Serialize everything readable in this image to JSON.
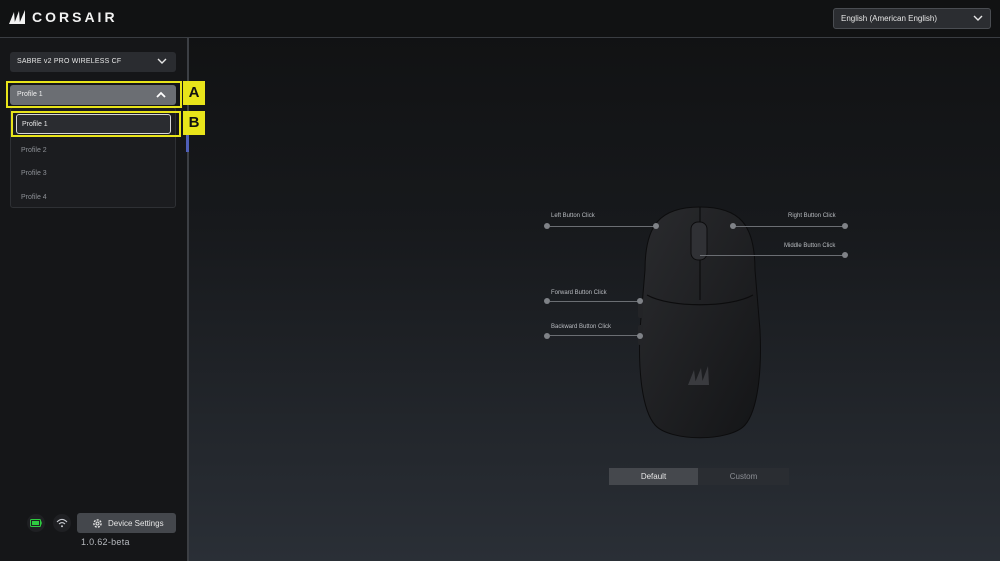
{
  "header": {
    "brand": "CORSAIR",
    "language": "English (American English)"
  },
  "sidebar": {
    "device": "SABRE v2 PRO WIRELESS CF",
    "profile_selected": "Profile 1",
    "profiles": [
      "Profile 1",
      "Profile 2",
      "Profile 3",
      "Profile 4"
    ],
    "device_settings_label": "Device Settings",
    "version": "1.0.62-beta"
  },
  "callouts": {
    "a": "A",
    "b": "B"
  },
  "mouse": {
    "left_button": "Left Button Click",
    "right_button": "Right Button Click",
    "middle_button": "Middle Button Click",
    "forward_button": "Forward Button Click",
    "backward_button": "Backward Button Click"
  },
  "mode_toggle": {
    "default": "Default",
    "custom": "Custom"
  },
  "colors": {
    "callout": "#e8e41a",
    "battery": "#2ecc40",
    "accent": "#4f5fb8"
  }
}
